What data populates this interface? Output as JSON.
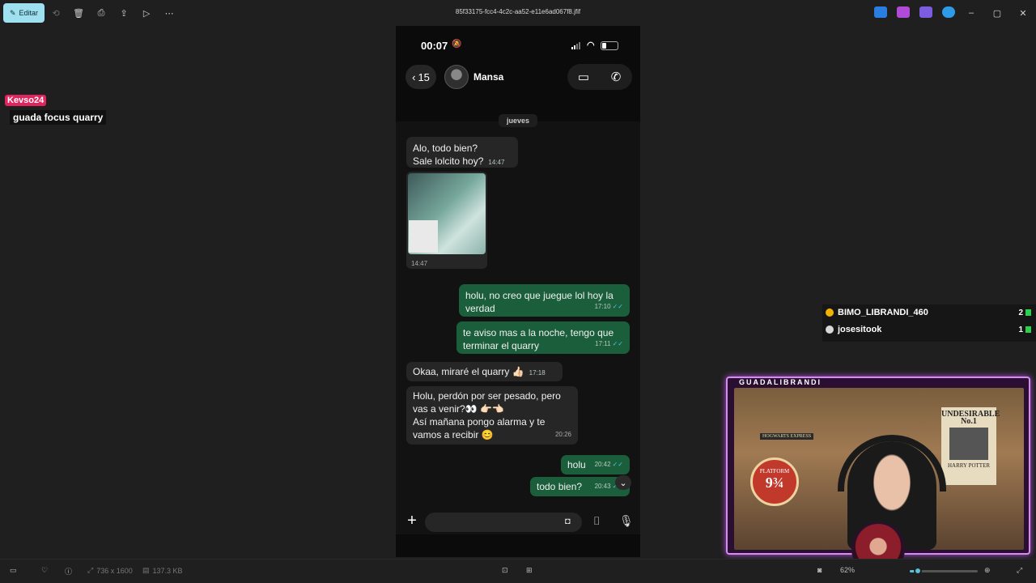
{
  "toolbar": {
    "edit_label": "Editar",
    "file_title": "85f33175-fcc4-4c2c-aa52-e11e6ad067f8.jfif"
  },
  "overlay_chat": {
    "user": "Kevso24",
    "message": "guada focus quarry"
  },
  "phone": {
    "status_time": "00:07",
    "back_count": "15",
    "contact_name": "Mansa",
    "day_label": "jueves",
    "messages": [
      {
        "dir": "in",
        "text1": "Alo, todo bien?",
        "text2": "Sale lolcito hoy?",
        "time": "14:47"
      },
      {
        "dir": "in-image",
        "time": "14:47"
      },
      {
        "dir": "out",
        "text1": "holu, no creo que juegue lol hoy la",
        "text2": "verdad",
        "time": "17:10"
      },
      {
        "dir": "out",
        "text1": "te aviso mas a la noche, tengo que",
        "text2": "terminar el quarry",
        "time": "17:11"
      },
      {
        "dir": "in",
        "text1": "Okaa, miraré el quarry 👍🏻",
        "time": "17:18"
      },
      {
        "dir": "in",
        "text1": "Holu, perdón por ser pesado, pero",
        "text2": "vas a venir?👀 👉🏻👈🏻",
        "text3": "Así mañana pongo alarma y te",
        "text4": "vamos a recibir 😊",
        "time": "20:26"
      },
      {
        "dir": "out",
        "text1": "holu",
        "time": "20:42"
      },
      {
        "dir": "out",
        "text1": "todo bien?",
        "time": "20:43"
      }
    ]
  },
  "gifts": [
    {
      "name": "BIMO_LIBRANDI_460",
      "count": "2",
      "color": "#f0b400"
    },
    {
      "name": "josesitook",
      "count": "1",
      "color": "#d8d8d8"
    }
  ],
  "webcam": {
    "channel": "GUADALIBRANDI",
    "poster_line1": "UNDESIRABLE",
    "poster_line2": "No.1",
    "poster_line3": "HARRY POTTER",
    "sign_text": "HOGWARTS EXPRESS",
    "platform_label": "PLATFORM",
    "platform_number": "9¾"
  },
  "statusbar": {
    "dimensions": "736 x 1600",
    "filesize": "137.3 KB",
    "zoom": "62%",
    "zoom_fraction": 0.12
  },
  "colors": {
    "accent": "#9fe0f0",
    "out_bubble": "#1b5e3b",
    "in_bubble": "#262626",
    "gift_bar": "#2dd04a"
  }
}
